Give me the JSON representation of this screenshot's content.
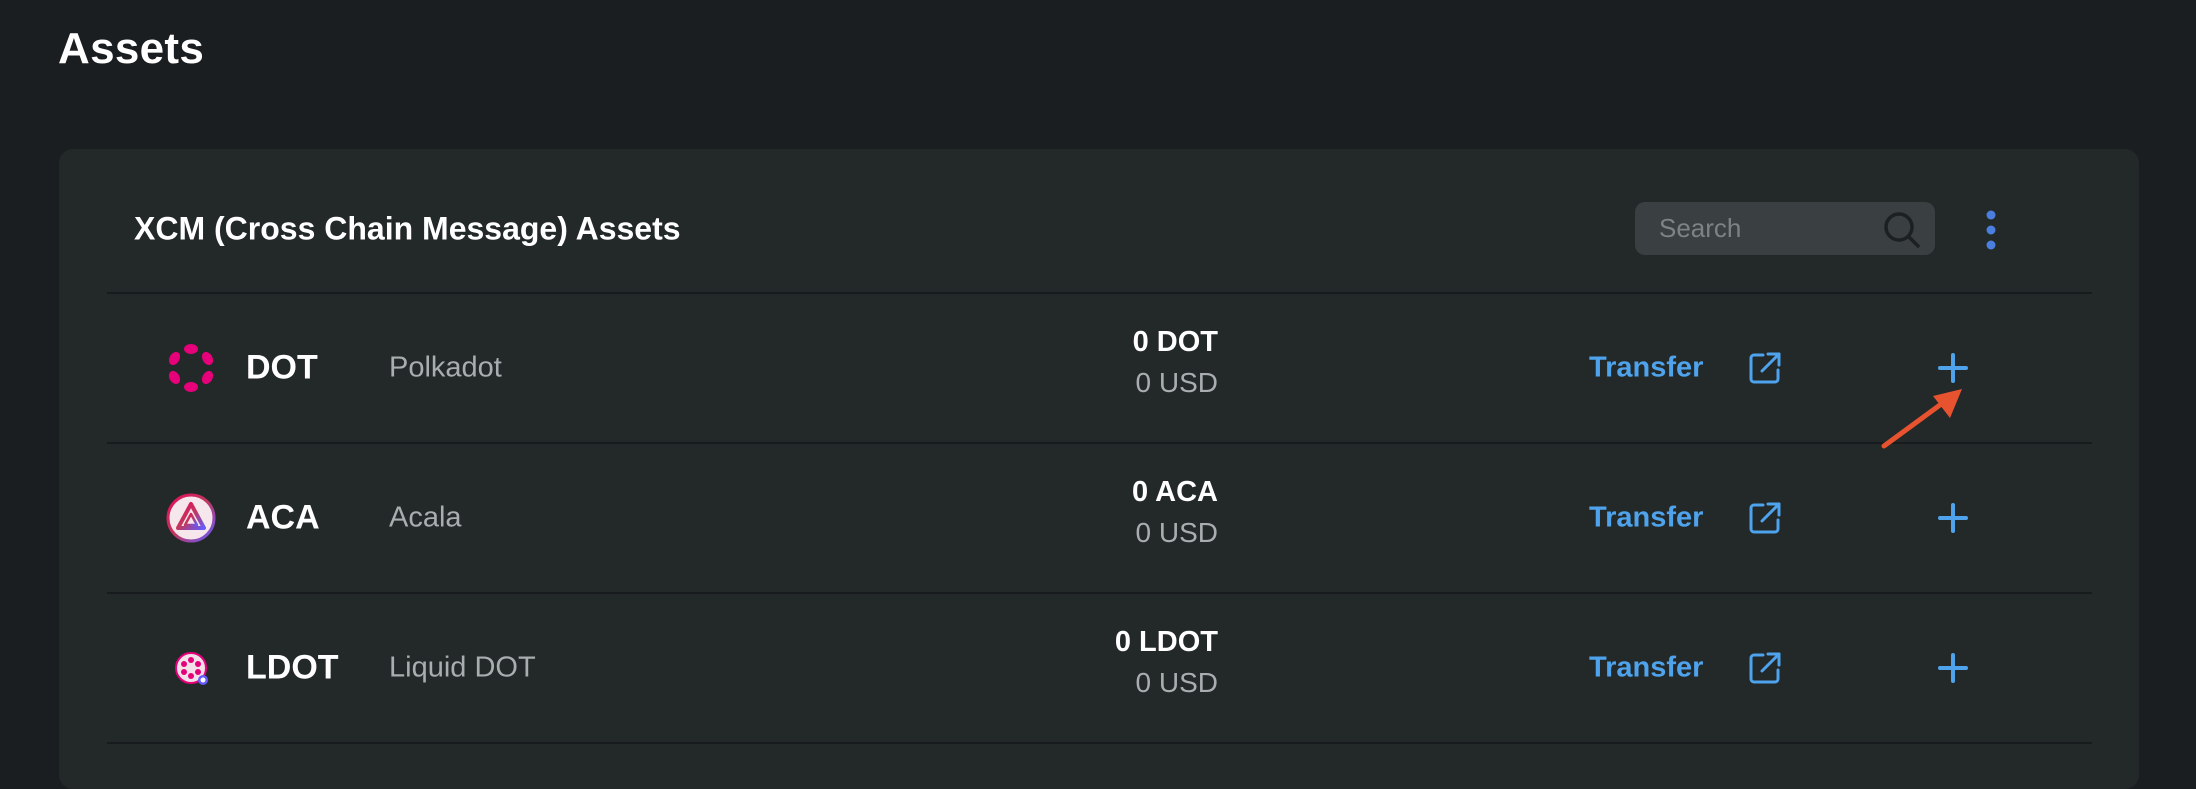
{
  "page": {
    "title": "Assets"
  },
  "panel": {
    "title": "XCM (Cross Chain Message) Assets",
    "search": {
      "placeholder": "Search",
      "value": ""
    },
    "more_icon": "more-vertical-icon"
  },
  "assets": [
    {
      "symbol": "DOT",
      "name": "Polkadot",
      "balance": "0 DOT",
      "usd": "0 USD",
      "transfer_label": "Transfer",
      "logo": "polkadot-logo",
      "logo_color": "#e6007a"
    },
    {
      "symbol": "ACA",
      "name": "Acala",
      "balance": "0 ACA",
      "usd": "0 USD",
      "transfer_label": "Transfer",
      "logo": "acala-logo",
      "logo_color": "#e40c5b"
    },
    {
      "symbol": "LDOT",
      "name": "Liquid DOT",
      "balance": "0 LDOT",
      "usd": "0 USD",
      "transfer_label": "Transfer",
      "logo": "liquid-dot-logo",
      "logo_color": "#e6007a"
    }
  ],
  "colors": {
    "background": "#1b1e20",
    "panel": "#232829",
    "accent": "#4ea3ec",
    "annotation": "#e8532f"
  }
}
